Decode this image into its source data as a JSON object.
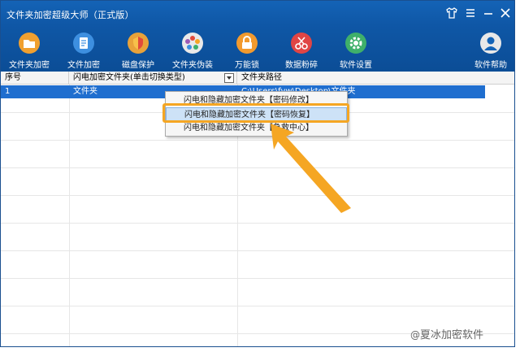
{
  "window": {
    "title": "文件夹加密超级大师（正式版）",
    "controls": [
      "shirt-icon",
      "menu-icon",
      "minimize-icon",
      "close-icon"
    ]
  },
  "toolbar": {
    "items": [
      {
        "label": "文件夹加密",
        "icon": "folder-lock-icon",
        "color": "#f0a030"
      },
      {
        "label": "文件加密",
        "icon": "file-lock-icon",
        "color": "#3d8fe0"
      },
      {
        "label": "磁盘保护",
        "icon": "shield-icon",
        "color": "#e8a23a"
      },
      {
        "label": "文件夹伪装",
        "icon": "pinwheel-icon",
        "color": "#e9e9e9"
      },
      {
        "label": "万能锁",
        "icon": "padlock-icon",
        "color": "#f29a2e"
      },
      {
        "label": "数据粉碎",
        "icon": "scissors-icon",
        "color": "#e04545"
      },
      {
        "label": "软件设置",
        "icon": "gear-icon",
        "color": "#3fb06a"
      }
    ],
    "help": {
      "label": "软件帮助",
      "icon": "user-icon",
      "color": "#e8e8e8"
    }
  },
  "table": {
    "columns": [
      "序号",
      "闪电加密文件夹(单击切换类型)",
      "文件夹路径"
    ],
    "rows": [
      {
        "index": "1",
        "type": "文件夹",
        "path": "C:\\Users\\fyw\\Desktop\\文件夹"
      }
    ]
  },
  "context_menu": {
    "items": [
      {
        "label": "闪电和隐藏加密文件夹【密码修改】",
        "selected": false
      },
      {
        "label": "闪电和隐藏加密文件夹【密码恢复】",
        "selected": true
      },
      {
        "label": "闪电和隐藏加密文件夹【急救中心】",
        "selected": false
      }
    ]
  },
  "annotation": {
    "highlight_color": "#f5a623"
  },
  "watermark": {
    "prefix": "@",
    "text": "夏冰加密软件"
  }
}
